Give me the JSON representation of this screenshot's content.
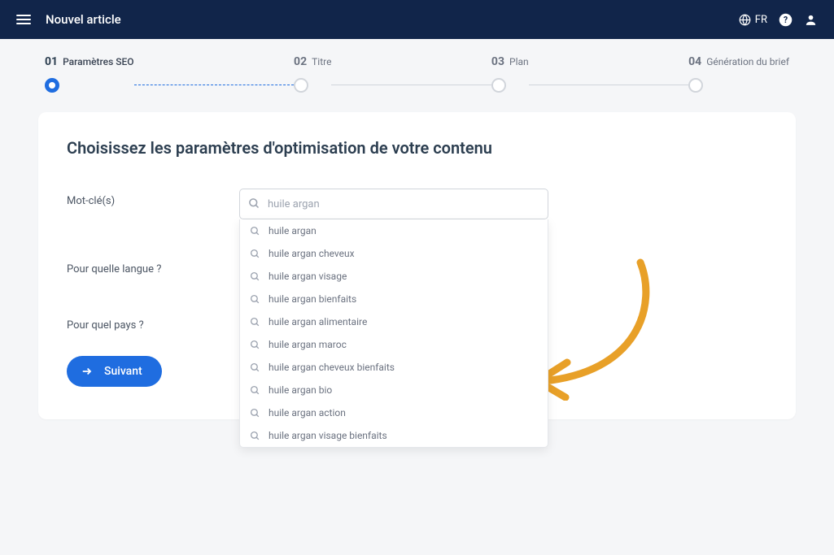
{
  "header": {
    "title": "Nouvel article",
    "lang": "FR"
  },
  "stepper": {
    "steps": [
      {
        "num": "01",
        "label": "Paramètres SEO"
      },
      {
        "num": "02",
        "label": "Titre"
      },
      {
        "num": "03",
        "label": "Plan"
      },
      {
        "num": "04",
        "label": "Génération du brief"
      }
    ]
  },
  "card": {
    "title": "Choisissez les paramètres d'optimisation de votre contenu",
    "labels": {
      "keyword": "Mot-clé(s)",
      "language": "Pour quelle langue ?",
      "country": "Pour quel pays ?"
    },
    "input": {
      "value": "huile argan"
    },
    "suggestions": [
      "huile argan",
      "huile argan cheveux",
      "huile argan visage",
      "huile argan bienfaits",
      "huile argan alimentaire",
      "huile argan maroc",
      "huile argan cheveux bienfaits",
      "huile argan bio",
      "huile argan action",
      "huile argan visage bienfaits"
    ],
    "nextButton": "Suivant"
  },
  "colors": {
    "accent": "#1f6de0",
    "headerBg": "#11254a",
    "annotation": "#e8a028"
  }
}
